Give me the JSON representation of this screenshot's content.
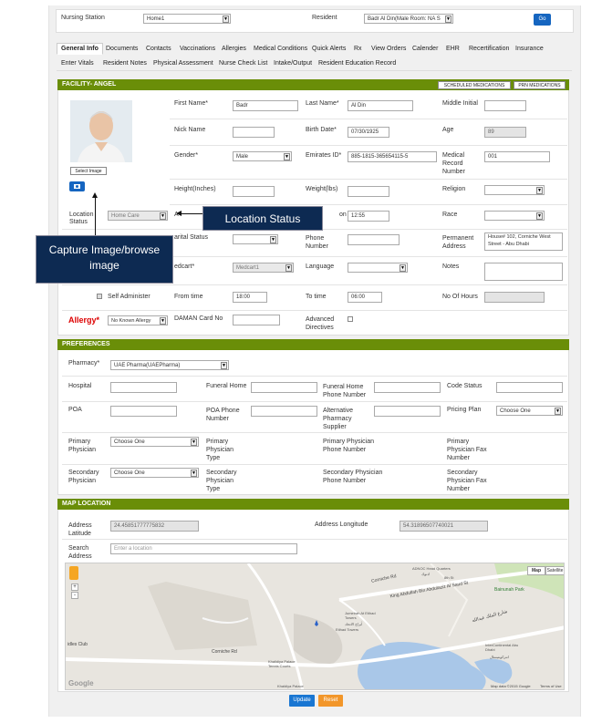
{
  "header": {
    "nursing_station_label": "Nursing Station",
    "nursing_station_value": "Home1",
    "resident_label": "Resident",
    "resident_value": "Badr Al Din(Male Room: NA S",
    "go_label": "Go"
  },
  "tabs_row1": [
    "General Info",
    "Documents",
    "Contacts",
    "Vaccinations",
    "Allergies",
    "Medical Conditions",
    "Quick Alerts",
    "Rx",
    "View Orders",
    "Calender",
    "EHR",
    "Recertification",
    "Insurance"
  ],
  "tabs_row2": [
    "Enter Vitals",
    "Resident Notes",
    "Physical Assessment",
    "Nurse Check List",
    "Intake/Output",
    "Resident Education Record"
  ],
  "facility": {
    "title": "FACILITY- ANGEL",
    "scheduled_btn": "SCHEDULED MEDICATIONS",
    "prn_btn": "PRN MEDICATIONS",
    "select_image": "Select Image",
    "first_name_label": "First Name*",
    "first_name": "Badr",
    "last_name_label": "Last Name*",
    "last_name": "Al Din",
    "middle_initial_label": "Middle Initial",
    "middle_initial": "",
    "nick_name_label": "Nick Name",
    "nick_name": "",
    "birth_date_label": "Birth Date*",
    "birth_date": "07/30/1925",
    "age_label": "Age",
    "age": "89",
    "gender_label": "Gender*",
    "gender": "Male",
    "emirates_label": "Emirates ID*",
    "emirates": "885-1815-365654115-5",
    "mrn_label": "Medical Record Number",
    "mrn": "001",
    "height_label": "Height(Inches)",
    "weight_label": "Weight(lbs)",
    "religion_label": "Religion",
    "location_status_label": "Location Status",
    "location_status": "Home Care",
    "time_value": "12:55",
    "race_label": "Race",
    "marital_label": "arital Status",
    "phone_label": "Phone Number",
    "address_label": "Permanent Address",
    "address": "House# 102, Corniche West Street - Abu Dhabi",
    "medcart_label": "edcart*",
    "medcart": "Medcart1",
    "language_label": "Language",
    "notes_label": "Notes",
    "self_admin_label": "Self Administer",
    "from_time_label": "From time",
    "from_time": "18:00",
    "to_time_label": "To time",
    "to_time": "06:00",
    "hours_label": "No Of Hours",
    "allergy_label": "Allergy*",
    "allergy": "No Known Allergy",
    "daman_label": "DAMAN Card No",
    "advance_label": "Advanced Directives",
    "at_prefix": "A",
    "on_suffix": "on"
  },
  "callouts": {
    "location_status": "Location Status",
    "capture": "Capture Image/browse image"
  },
  "preferences": {
    "title": "PREFERENCES",
    "pharmacy_label": "Pharmacy*",
    "pharmacy": "UAE Pharma(UAEPharma)",
    "hospital_label": "Hospital",
    "funeral_label": "Funeral Home",
    "funeral_phone_label": "Funeral Home Phone Number",
    "code_status_label": "Code Status",
    "poa_label": "POA",
    "poa_phone_label": "POA Phone Number",
    "alt_pharmacy_label": "Alternative Pharmacy Supplier",
    "pricing_label": "Pricing Plan",
    "pricing": "Choose One",
    "primary_phys_label": "Primary Physician",
    "primary_phys": "Choose One",
    "primary_type_label": "Primary Physician Type",
    "primary_phone_label": "Primary Physician Phone Number",
    "primary_fax_label": "Primary Physician Fax Number",
    "secondary_phys_label": "Secondary Physician",
    "secondary_phys": "Choose One",
    "secondary_type_label": "Secondary Physician Type",
    "secondary_phone_label": "Secondary Physician Phone Number",
    "secondary_fax_label": "Secondary Physician Fax Number"
  },
  "map": {
    "title": "MAP LOCATION",
    "lat_label": "Address Latitude",
    "lat": "24.45851777775832",
    "lng_label": "Address Longitude",
    "lng": "54.31896507740021",
    "search_label": "Search Address",
    "search_placeholder": "Enter a location",
    "map_btn": "Map",
    "satellite_btn": "Satellite",
    "labels": {
      "adnoc": "ADNOC Head Quarters",
      "corniche1": "Corniche Rd",
      "corniche2": "Corniche Rd",
      "khalidiya": "Khalidiya Palace Tennis Courts",
      "khalidiya2": "Khaldiya Palace",
      "jumeirah": "Jumeirah At Etihad Towers",
      "etihad": "Etihad Towers",
      "club": "idles Club",
      "bainunah": "Bainunah Park",
      "intercon": "InterContinental Abu Dhabi",
      "street": "King Abdullah Bin Abdulaziz Al Saud St",
      "arabic1": "شارع الملك عبدالله",
      "arabic2": "أبراج الاتحاد",
      "arabic3": "انتركونتيننتال",
      "arabic4": "ادنوك",
      "google": "Google",
      "attrib": "Map data ©2015 Google",
      "terms": "Terms of Use",
      "street_num": "8th St"
    }
  },
  "footer": {
    "update": "Update",
    "reset": "Reset"
  },
  "colors": {
    "green": "#6a8e08",
    "blue": "#1565c0",
    "callout": "#0d2a52",
    "allergy": "#d00000",
    "reset": "#f2962a"
  }
}
